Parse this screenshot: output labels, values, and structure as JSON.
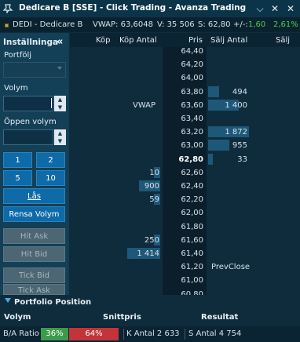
{
  "window": {
    "title": "Dedicare B [SSE] - Click Trading - Avanza Trading",
    "pin_icon": "pin-icon",
    "close_icon": "close-x-icon",
    "collapse_icon": "chevron-down-icon"
  },
  "instrument": {
    "symbol_line": "DEDI - Dedicare B",
    "vwap": "VWAP: 63,6048",
    "volume": "V: 35 506",
    "last": "S: 62,80",
    "change_label": "+/-:",
    "change": "1,60",
    "change_pct": "2,61%"
  },
  "settings": {
    "title": "Inställninga",
    "collapse_glyph": "«",
    "portfolio_label": "Portfölj",
    "volume_label": "Volym",
    "volume_value": "",
    "open_volume_label": "Öppen volym",
    "open_volume_value": "",
    "buttons": {
      "q1": "1",
      "q2": "2",
      "q5": "5",
      "q10": "10",
      "lock": "Lås",
      "clear_volume": "Rensa Volym",
      "hit_ask": "Hit Ask",
      "hit_bid": "Hit Bid",
      "tick_bid": "Tick Bid",
      "tick_ask": "Tick Ask"
    }
  },
  "ladder": {
    "headers": {
      "buy": "Köp",
      "buy_qty": "Köp Antal",
      "price": "Pris",
      "sell_qty": "Sälj Antal",
      "sell": "Sälj"
    },
    "rows": [
      {
        "price": "64,40",
        "buy_qty": "",
        "sell_qty": "",
        "note": ""
      },
      {
        "price": "64,20",
        "buy_qty": "",
        "sell_qty": "",
        "note": ""
      },
      {
        "price": "64,00",
        "buy_qty": "",
        "sell_qty": "",
        "note": ""
      },
      {
        "price": "63,80",
        "buy_qty": "",
        "sell_qty": "494",
        "note": ""
      },
      {
        "price": "63,60",
        "buy_qty": "",
        "sell_qty": "1 400",
        "note": "VWAP"
      },
      {
        "price": "63,40",
        "buy_qty": "",
        "sell_qty": "",
        "note": ""
      },
      {
        "price": "63,20",
        "buy_qty": "",
        "sell_qty": "1 872",
        "note": ""
      },
      {
        "price": "63,00",
        "buy_qty": "",
        "sell_qty": "955",
        "note": ""
      },
      {
        "price": "62,80",
        "buy_qty": "",
        "sell_qty": "33",
        "note": "",
        "last": true
      },
      {
        "price": "62,60",
        "buy_qty": "10",
        "sell_qty": "",
        "note": ""
      },
      {
        "price": "62,40",
        "buy_qty": "900",
        "sell_qty": "",
        "note": ""
      },
      {
        "price": "62,20",
        "buy_qty": "59",
        "sell_qty": "",
        "note": ""
      },
      {
        "price": "62,00",
        "buy_qty": "",
        "sell_qty": "",
        "note": ""
      },
      {
        "price": "61,80",
        "buy_qty": "",
        "sell_qty": "",
        "note": ""
      },
      {
        "price": "61,60",
        "buy_qty": "250",
        "sell_qty": "",
        "note": ""
      },
      {
        "price": "61,40",
        "buy_qty": "1 414",
        "sell_qty": "",
        "note": ""
      },
      {
        "price": "61,20",
        "buy_qty": "",
        "sell_qty": "",
        "note": "PrevClose"
      },
      {
        "price": "61,00",
        "buy_qty": "",
        "sell_qty": "",
        "note": ""
      },
      {
        "price": "60,80",
        "buy_qty": "",
        "sell_qty": "",
        "note": ""
      }
    ]
  },
  "portfolio": {
    "title": "Portfolio Position",
    "col_volume": "Volym",
    "col_avg_price": "Snittpris",
    "col_result": "Resultat"
  },
  "status": {
    "ratio_label": "B/A Ratio",
    "buy_pct": "36%",
    "sell_pct": "64%",
    "buy_count": "K Antal 2 633",
    "sell_count": "S Antal 4 754"
  },
  "colors": {
    "accent": "#0f6aa8",
    "change_positive": "#3fd14f",
    "buy_ratio": "#3b9b4a",
    "sell_ratio": "#c2343a"
  }
}
